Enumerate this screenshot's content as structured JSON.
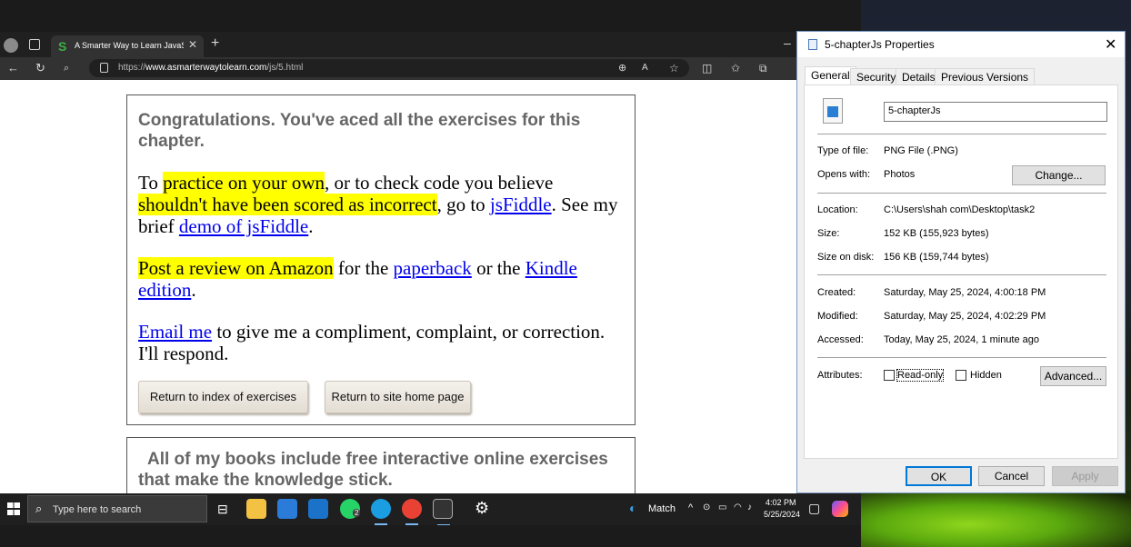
{
  "browser": {
    "tab_title": "A Smarter Way to Learn JavaScript",
    "tab_favicon": "S",
    "url_prefix": "https://",
    "url_host": "www.asmarterwaytolearn.com",
    "url_path": "/js/5.html"
  },
  "page": {
    "heading": "Congratulations. You've aced all the exercises for this chapter.",
    "p1": {
      "t1": "To ",
      "h1": "practice on your own",
      "t2": ", or to check code you believe ",
      "h2": "shouldn't have been scored as incorrect",
      "t3": ", go to ",
      "link_jsfiddle": "jsFiddle",
      "t4": ". See my brief ",
      "link_demo": "demo of jsFiddle",
      "t5": "."
    },
    "p2": {
      "h1": "Post a review on Amazon",
      "t1": " for the ",
      "link_paperback": "paperback",
      "t2": " or the ",
      "link_kindle": "Kindle edition",
      "t3": "."
    },
    "p3": {
      "link_email": "Email me",
      "t1": " to give me a compliment, complaint, or correction. I'll respond."
    },
    "btn_index": "Return to index of exercises",
    "btn_home": "Return to site home page",
    "heading2": "All of my books include free interactive online exercises that make the knowledge stick."
  },
  "dialog": {
    "title": "5-chapterJs Properties",
    "tabs": [
      "General",
      "Security",
      "Details",
      "Previous Versions"
    ],
    "file_name": "5-chapterJs",
    "type_label": "Type of file:",
    "type_value": "PNG File (.PNG)",
    "opens_label": "Opens with:",
    "opens_value": "Photos",
    "change_btn": "Change...",
    "location_label": "Location:",
    "location_value": "C:\\Users\\shah com\\Desktop\\task2",
    "size_label": "Size:",
    "size_value": "152 KB (155,923 bytes)",
    "disk_label": "Size on disk:",
    "disk_value": "156 KB (159,744 bytes)",
    "created_label": "Created:",
    "created_value": "Saturday, May 25, 2024, 4:00:18 PM",
    "modified_label": "Modified:",
    "modified_value": "Saturday, May 25, 2024, 4:02:29 PM",
    "accessed_label": "Accessed:",
    "accessed_value": "Today, May 25, 2024, 1 minute ago",
    "attributes_label": "Attributes:",
    "readonly_label": "Read-only",
    "hidden_label": "Hidden",
    "advanced_btn": "Advanced...",
    "ok": "OK",
    "cancel": "Cancel",
    "apply": "Apply"
  },
  "taskbar": {
    "search_placeholder": "Type here to search",
    "whatsapp_badge": "2",
    "weather_text": "Match",
    "time": "4:02 PM",
    "date": "5/25/2024"
  }
}
